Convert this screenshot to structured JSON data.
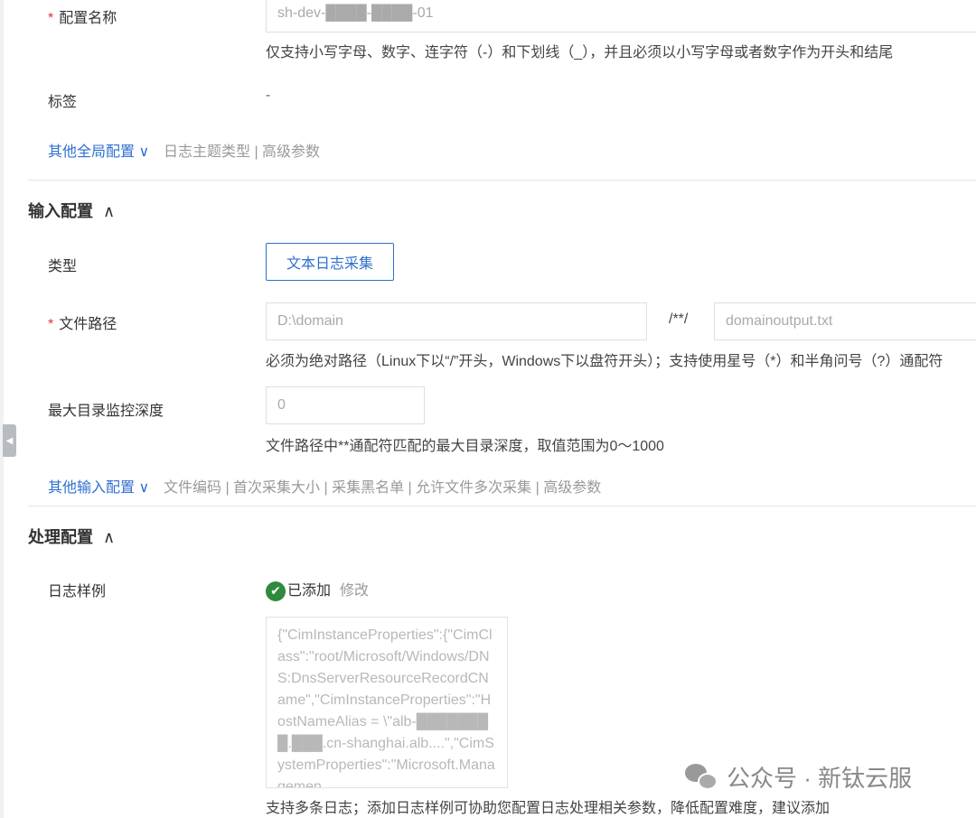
{
  "global": {
    "name_label": "配置名称",
    "name_value": "sh-dev-████-████-01",
    "name_hint": "仅支持小写字母、数字、连字符（-）和下划线（_），并且必须以小写字母或者数字作为开头和结尾",
    "tag_label": "标签",
    "tag_value": "-",
    "other_link": "其他全局配置",
    "other_items": "日志主题类型 | 高级参数"
  },
  "input": {
    "heading": "输入配置",
    "type_label": "类型",
    "type_button": "文本日志采集",
    "path_label": "文件路径",
    "path_dir": "D:\\domain",
    "path_sep": "/**/",
    "path_file": "domainoutput.txt",
    "path_hint": "必须为绝对路径（Linux下以“/”开头，Windows下以盘符开头）；支持使用星号（*）和半角问号（?）通配符",
    "depth_label": "最大目录监控深度",
    "depth_value": "0",
    "depth_hint": "文件路径中**通配符匹配的最大目录深度，取值范围为0～1000",
    "other_link": "其他输入配置",
    "other_items": "文件编码 | 首次采集大小 | 采集黑名单 | 允许文件多次采集 | 高级参数"
  },
  "process": {
    "heading": "处理配置",
    "sample_label": "日志样例",
    "status": "已添加",
    "edit": "修改",
    "sample_text": "{\"CimInstanceProperties\":{\"CimClass\":\"root/Microsoft/Windows/DNS:DnsServerResourceRecordCName\",\"CimInstanceProperties\":\"HostNameAlias = \\\"alb-████████.███.cn-shanghai.alb....\",\"CimSystemProperties\":\"Microsoft.Managemen",
    "sample_hint": "支持多条日志；添加日志样例可协助您配置日志处理相关参数，降低配置难度，建议添加"
  },
  "watermark": "公众号 · 新钛云服"
}
